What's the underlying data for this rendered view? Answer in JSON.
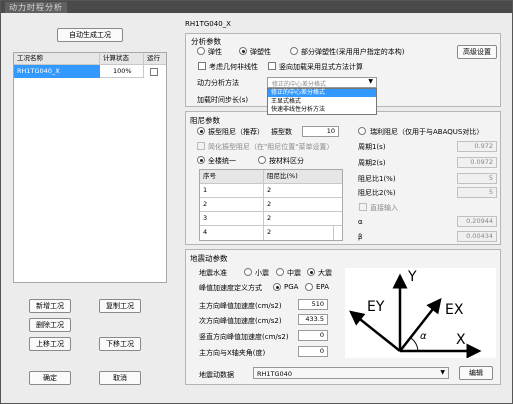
{
  "window": {
    "title": "动力时程分析"
  },
  "left": {
    "auto_generate_label": "自动生成工况",
    "table": {
      "headers": [
        "工况名称",
        "计算状态",
        "运行"
      ],
      "rows": [
        {
          "name": "RH1TG040_X",
          "status": "100%",
          "run": false
        }
      ]
    },
    "buttons": {
      "new": "新增工况",
      "copy": "复制工况",
      "delete": "删除工况",
      "up": "上移工况",
      "down": "下移工况",
      "ok": "确定",
      "cancel": "取消"
    }
  },
  "case_name": "RH1TG040_X",
  "analysis": {
    "title": "分析参数",
    "options": [
      "弹性",
      "弹塑性",
      "部分弹塑性(采用用户指定的本构)"
    ],
    "selected": "弹塑性",
    "advanced_label": "高级设置",
    "geo_nonlinear": "考虑几何非线性",
    "vertical_load": "竖向加载采用显式方法计算",
    "method_label": "动力分析方法",
    "method_value": "修正的中心差分格式",
    "method_options": [
      "修正的中心差分格式",
      "王显式格式",
      "快速非线性分析方法"
    ],
    "step_label": "加载时间步长(s)"
  },
  "damping": {
    "title": "阻尼参数",
    "modal_label": "振型阻尼（推荐）",
    "modal_count_label": "振型数",
    "modal_count": "10",
    "rayleigh_label": "瑞利阻尼（仅用于与ABAQUS对比）",
    "simplified_label": "简化振型阻尼（在\"阻尼位置\"菜单设置）",
    "uniform_label": "全楼统一",
    "by_material_label": "按材料区分",
    "table": {
      "headers": [
        "序号",
        "阻尼比(%)"
      ],
      "rows": [
        [
          "1",
          "2"
        ],
        [
          "2",
          "2"
        ],
        [
          "3",
          "2"
        ],
        [
          "4",
          "2"
        ]
      ]
    },
    "period1_label": "周期1(s)",
    "period1": "0.972",
    "period2_label": "周期2(s)",
    "period2": "0.0972",
    "ratio1_label": "阻尼比1(%)",
    "ratio1": "5",
    "ratio2_label": "阻尼比2(%)",
    "ratio2": "5",
    "direct_input_label": "直接输入",
    "alpha_label": "α",
    "alpha": "0.20944",
    "beta_label": "β",
    "beta": "0.00434"
  },
  "seismic": {
    "title": "地震动参数",
    "level_label": "地震水准",
    "levels": [
      "小震",
      "中震",
      "大震"
    ],
    "level_selected": "大震",
    "peak_def_label": "峰值加速度定义方式",
    "peak_options": [
      "PGA",
      "EPA"
    ],
    "peak_selected": "PGA",
    "main_label": "主方向峰值加速度(cm/s2)",
    "main": "510",
    "sub_label": "次方向峰值加速度(cm/s2)",
    "sub": "433.5",
    "vert_label": "竖直方向峰值加速度(cm/s2)",
    "vert": "0",
    "angle_label": "主方向与X轴夹角(度)",
    "angle": "0",
    "data_label": "地震动数据",
    "data_value": "RH1TG040",
    "edit_label": "编辑",
    "diagram": {
      "y": "Y",
      "ey": "EY",
      "ex": "EX",
      "x": "X",
      "alpha": "α"
    }
  }
}
